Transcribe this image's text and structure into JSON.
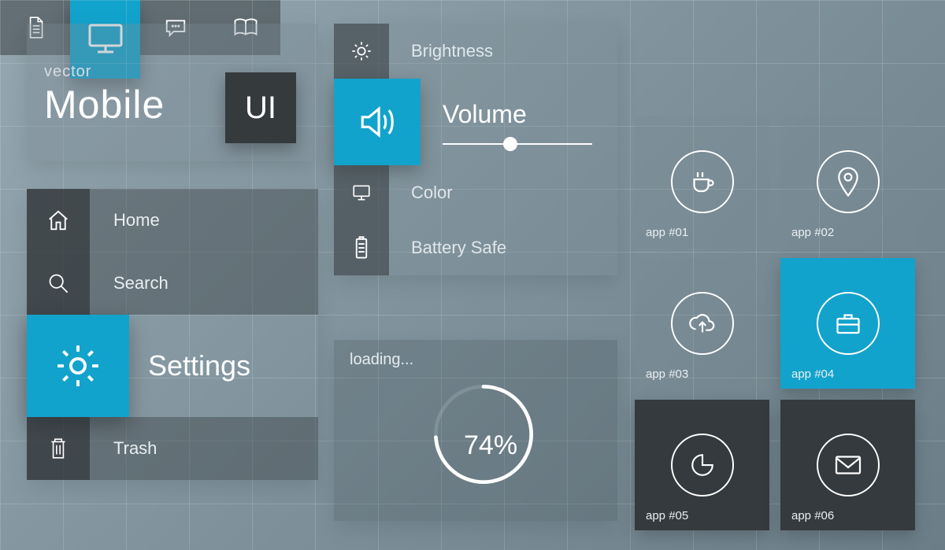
{
  "title_block": {
    "subtitle": "vector",
    "title": "Mobile",
    "badge": "UI"
  },
  "nav": {
    "items": [
      {
        "label": "Home"
      },
      {
        "label": "Search"
      },
      {
        "label": "Settings"
      },
      {
        "label": "Trash"
      }
    ]
  },
  "settings": {
    "items": [
      {
        "label": "Brightness"
      },
      {
        "label": "Volume"
      },
      {
        "label": "Color"
      },
      {
        "label": "Battery Safe"
      }
    ],
    "volume_slider_pct": 45
  },
  "loading": {
    "label": "loading...",
    "percent_text": "74%",
    "percent": 74
  },
  "apps": {
    "labels": [
      "app #01",
      "app #02",
      "app #03",
      "app #04",
      "app #05",
      "app #06"
    ]
  },
  "colors": {
    "accent": "#12a3cc",
    "dark": "#343a3d"
  }
}
